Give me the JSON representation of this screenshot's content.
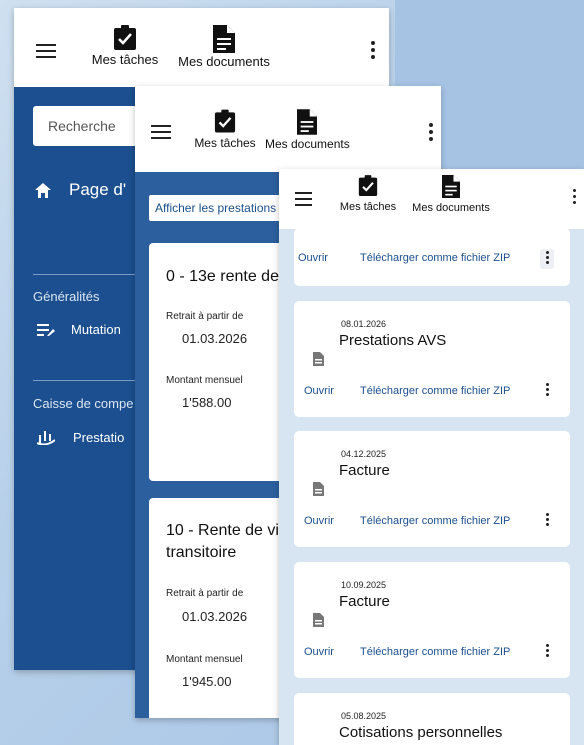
{
  "nav": {
    "tasks_label": "Mes tâches",
    "documents_label": "Mes documents"
  },
  "window1": {
    "search_placeholder": "Recherche",
    "home_label": "Page d'",
    "section_general": "Généralités",
    "mutations_label": "Mutation",
    "section_caisse": "Caisse de compe",
    "prestations_label": "Prestatio"
  },
  "window2": {
    "filter_label": "Afficher les prestations",
    "cards": [
      {
        "title": "0 - 13e rente de v",
        "withdrawal_label": "Retrait à partir de",
        "withdrawal_date": "01.03.2026",
        "monthly_label": "Montant mensuel",
        "monthly_amount": "1'588.00"
      },
      {
        "title": "10 - Rente de viei transitoire",
        "withdrawal_label": "Retrait à partir de",
        "withdrawal_date": "01.03.2026",
        "monthly_label": "Montant mensuel",
        "monthly_amount": "1'945.00"
      }
    ]
  },
  "window3": {
    "open_label": "Ouvrir",
    "zip_label": "Télécharger comme fichier ZIP",
    "documents": [
      {
        "date": "08.01.2026",
        "title": "Prestations AVS"
      },
      {
        "date": "04.12.2025",
        "title": "Facture"
      },
      {
        "date": "10.09.2025",
        "title": "Facture"
      },
      {
        "date": "05.08.2025",
        "title": "Cotisations personnelles"
      }
    ]
  }
}
